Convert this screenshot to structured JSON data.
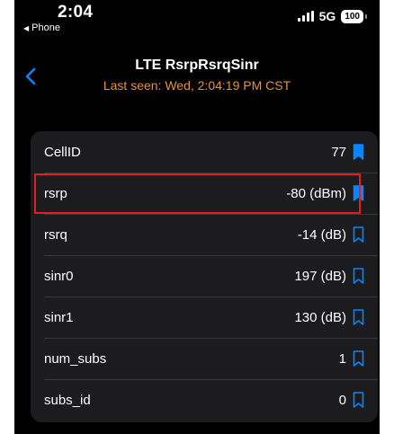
{
  "status_bar": {
    "time": "2:04",
    "back_app": "Phone",
    "network": "5G",
    "battery": "100"
  },
  "nav": {
    "title": "LTE RsrpRsrqSinr",
    "subtitle": "Last seen: Wed, 2:04:19 PM CST"
  },
  "colors": {
    "accent": "#0a84ff",
    "subtitle": "#e8913b",
    "highlight": "#e11d1d"
  },
  "rows": [
    {
      "label": "CellID",
      "value": "77",
      "bookmark": "bookmark-filled-icon"
    },
    {
      "label": "rsrp",
      "value": "-80 (dBm)",
      "bookmark": "bookmark-filled-icon",
      "highlighted": true
    },
    {
      "label": "rsrq",
      "value": "-14 (dB)",
      "bookmark": "bookmark-outline-icon"
    },
    {
      "label": "sinr0",
      "value": "197 (dB)",
      "bookmark": "bookmark-outline-icon"
    },
    {
      "label": "sinr1",
      "value": "130 (dB)",
      "bookmark": "bookmark-outline-icon"
    },
    {
      "label": "num_subs",
      "value": "1",
      "bookmark": "bookmark-outline-icon"
    },
    {
      "label": "subs_id",
      "value": "0",
      "bookmark": "bookmark-outline-icon"
    }
  ]
}
